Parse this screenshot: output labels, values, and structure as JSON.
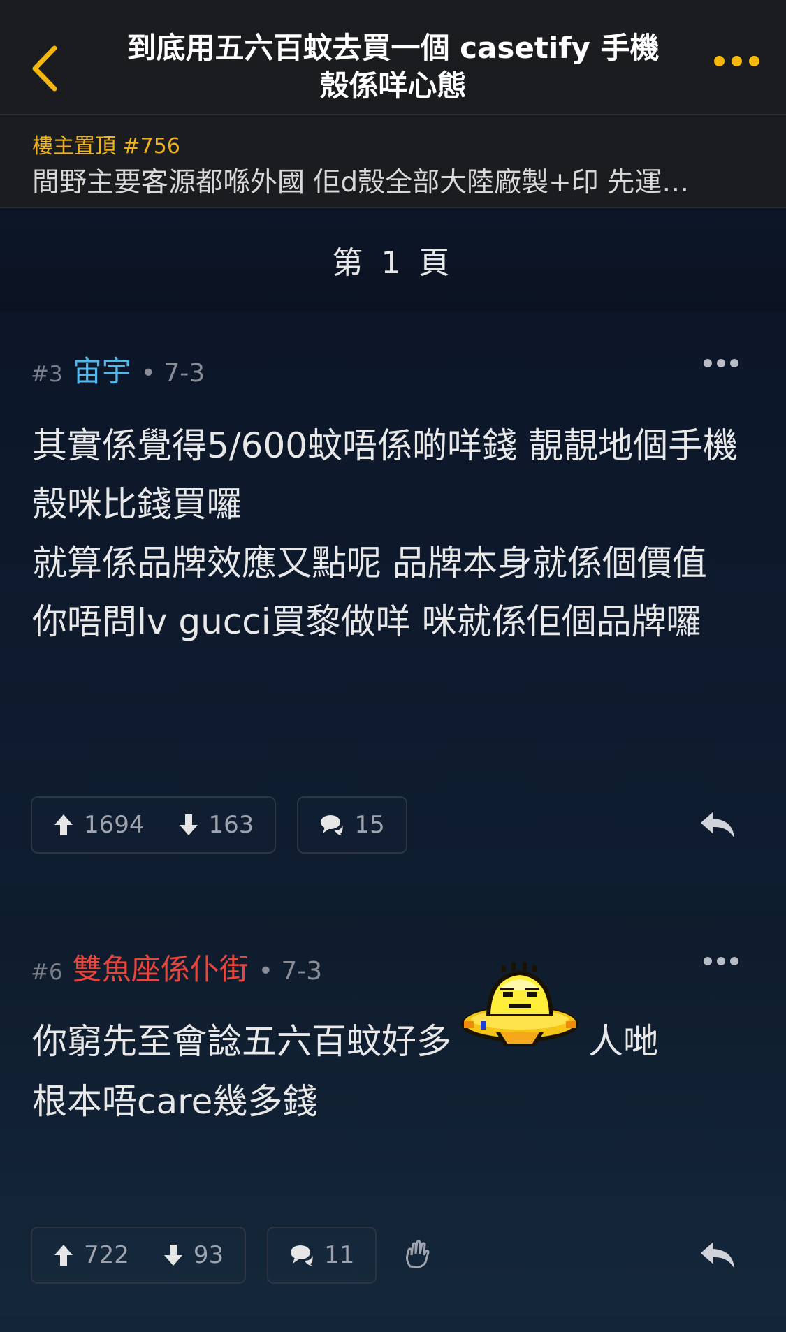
{
  "header": {
    "title": "到底用五六百蚊去買一個 casetify 手機殼係咩心態",
    "title_line1": "到底用五六百蚊去買一個 casetify 手機",
    "title_line2": "殼係咩心態",
    "accent": "#f6b70e"
  },
  "pinned": {
    "label": "樓主置頂 #756",
    "text": "間野主要客源都喺外國 佢d殼全部大陸廠製+印 先運…"
  },
  "page": {
    "label": "第 1 頁"
  },
  "posts": [
    {
      "number": "#3",
      "username": "宙宇",
      "username_color": "#4fb8ef",
      "date": "• 7-3",
      "lines": [
        "其實係覺得5/600蚊唔係啲咩錢 靚靚地個手機殼咪比錢買囉",
        "就算係品牌效應又點呢 品牌本身就係個價值",
        "你唔問lv gucci買黎做咩 咪就係佢個品牌囉"
      ],
      "upvotes": "1694",
      "downvotes": "163",
      "comments": "15"
    },
    {
      "number": "#6",
      "username": "雙魚座係仆街",
      "username_color": "#e5463d",
      "date": "• 7-3",
      "line1_before": "你窮先至會諗五六百蚊好多",
      "line1_after": "人哋",
      "line2": "根本唔care幾多錢",
      "emoji": "yellow-ufo-emoji",
      "upvotes": "722",
      "downvotes": "93",
      "comments": "11"
    }
  ],
  "icons": {
    "back": "chevron-left-icon",
    "more": "more-dots-icon",
    "upvote": "arrow-up-icon",
    "downvote": "arrow-down-icon",
    "comment": "comment-bubble-icon",
    "reply": "reply-arrow-icon",
    "hand": "raised-hand-icon"
  }
}
